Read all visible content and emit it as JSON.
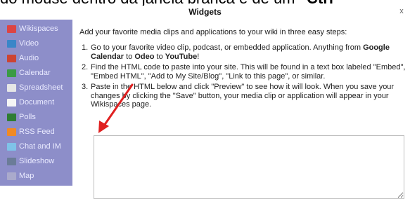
{
  "caption": {
    "text_before": "do mouse dentro da janela branca e de um ",
    "text_bold": "\"Ctrl",
    "text_after": ""
  },
  "window": {
    "title": "Widgets",
    "close_glyph": "x"
  },
  "sidebar": {
    "items": [
      {
        "label": "Wikispaces",
        "icon": "wikispaces-icon",
        "color": "#d44"
      },
      {
        "label": "Video",
        "icon": "video-icon",
        "color": "#3a86c8"
      },
      {
        "label": "Audio",
        "icon": "audio-icon",
        "color": "#c43"
      },
      {
        "label": "Calendar",
        "icon": "calendar-icon",
        "color": "#3b9b45"
      },
      {
        "label": "Spreadsheet",
        "icon": "spreadsheet-icon",
        "color": "#e6e6e6"
      },
      {
        "label": "Document",
        "icon": "document-icon",
        "color": "#f5f5f5"
      },
      {
        "label": "Polls",
        "icon": "polls-icon",
        "color": "#2e7d32"
      },
      {
        "label": "RSS Feed",
        "icon": "rss-icon",
        "color": "#f08a24"
      },
      {
        "label": "Chat and IM",
        "icon": "chat-icon",
        "color": "#7fc3e8"
      },
      {
        "label": "Slideshow",
        "icon": "slideshow-icon",
        "color": "#6b7c98"
      },
      {
        "label": "Map",
        "icon": "map-icon",
        "color": "#aac"
      }
    ]
  },
  "content": {
    "intro": "Add your favorite media clips and applications to your wiki in three easy steps:",
    "steps": [
      {
        "num": "1.",
        "parts": [
          {
            "t": "Go to your favorite video clip, podcast, or embedded application. Anything from ",
            "b": false
          },
          {
            "t": "Google Calendar",
            "b": true
          },
          {
            "t": " to ",
            "b": false
          },
          {
            "t": "Odeo",
            "b": true
          },
          {
            "t": " to ",
            "b": false
          },
          {
            "t": "YouTube",
            "b": true
          },
          {
            "t": "!",
            "b": false
          }
        ]
      },
      {
        "num": "2.",
        "parts": [
          {
            "t": "Find the HTML code to paste into your site. This will be found in a text box labeled \"Embed\", \"Embed HTML\", \"Add to My Site/Blog\", \"Link to this page\", or similar.",
            "b": false
          }
        ]
      },
      {
        "num": "3.",
        "parts": [
          {
            "t": "Paste in the HTML below and click \"Preview\" to see how it will look. When you save your changes by clicking the \"Save\" button, your media clip or application will appear in your Wikispaces page.",
            "b": false
          }
        ]
      }
    ],
    "textarea_value": ""
  },
  "annotation": {
    "arrow_color": "#e02020"
  }
}
